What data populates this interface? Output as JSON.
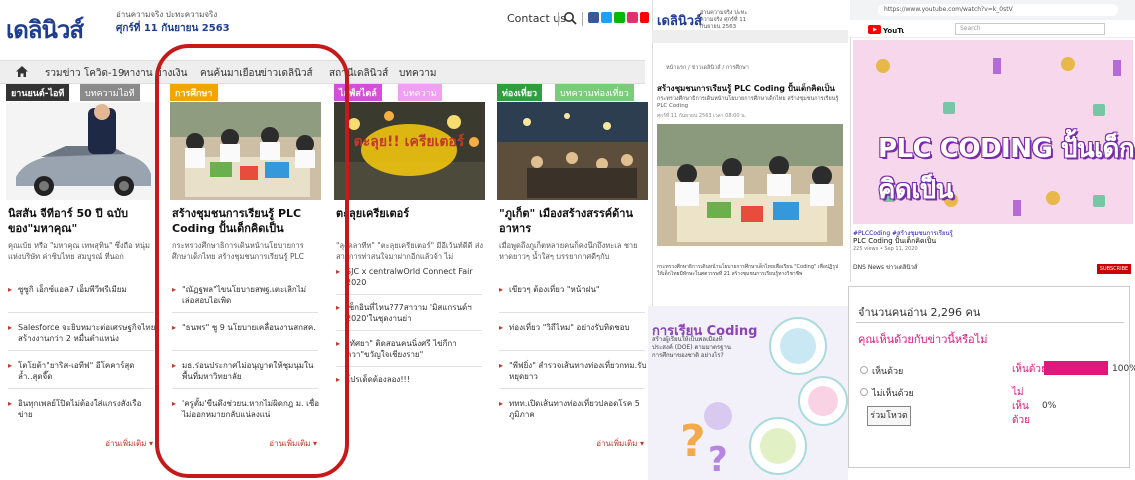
{
  "site": {
    "logo": "เดลินิวส์",
    "logo_tagline": "อ่านความจริง ปะทะความจริง",
    "date": "ศุกร์ที่ 11 กันยายน 2563",
    "contact": "Contact us",
    "nav": [
      "รวมข่าว โควิด-19",
      "หางาน",
      "ข้างเงิน",
      "คนค้นมาเยือน",
      "ข่าวเดลินิวส์",
      "สถานีเดลินิวส์",
      "บทความ"
    ],
    "columns": [
      {
        "tab": "ยานยนต์-ไอที",
        "tab2": "บทความไอที",
        "tab_color": "#333333",
        "tab2_color": "#8a8a8a",
        "title": "นิสสัน จีทีอาร์ 50 ปี ฉบับ ของ\"มหาคุณ\"",
        "excerpt": "คุณเบ้ย หรือ \"มหาคุณ เทพสุทิน\" ซึ่งถือ หนุ่มแห่งบริษัท ค่าซิบไทย สมบูรณ์ ที่นอก",
        "bullets": [
          "ซูซูกิ เอ็กซ์แอล7 เอ็มพีวีพรีเมียม",
          "Salesforce จะยิบหมาะต่อเศรษฐกิจไทย สร้างงานกว่า 2 หมื่นตำแหน่ง",
          "โตโยต้า\"ยาริส-เอทีฟ\" อีโคคาร์สุดล้ำ..สุดจี๊ด",
          "อินทุกเพลย์โปิดไม่ต้องใส่แกรงสังเรือข่าย"
        ],
        "more": "อ่านเพิ่มเติม ▾"
      },
      {
        "tab": "การศึกษา",
        "tab2": "",
        "tab_color": "#f0a500",
        "tab2_color": "",
        "title": "สร้างชุมชนการเรียนรู้ PLC Coding ปั้นเด็กคิดเป็น",
        "excerpt": "กระทรวงศึกษาธิการเดินหน้านโยบายการศึกษาเด็กไทย สร้างชุมชนการเรียนรู้ PLC",
        "bullets": [
          "\"ณัฏฐพล\"ไขนโยบายสพฐ.เตะเลิกไม่ เล่อสอบไอเพิด",
          "\"ธนพร\" ชู 9 นโยบายเคลื่อนงานสกสค.",
          "มธ.ร่อนประกาศไม่อนุญาตให้ชุมนุมใน พื้นที่มหาวิทยาลัย",
          "'ครูตั้ม'ขืนดึงช่วยน.หากไม่ผิดกฎ ม. เชื่อ ไม่ออกหมายกลับแน่ลงแน่"
        ],
        "more": "อ่านเพิ่มเติม ▾"
      },
      {
        "tab": "ไลฟ์สไตล์",
        "tab2": "บทความ",
        "tab_color": "#d24fd8",
        "tab2_color": "#f0a0f0",
        "title": "ตะลุยเครียเตอร์",
        "excerpt": "\"ลุงคลาทีท\" \"ตะลุยเครียเตอร์\" มีอีเว้นท์ดีดี ส่งสารการท่าสนใจมาฝากอีกแล้วจ้า ไม่",
        "bullets": [
          "SJC x centralwOrld Connect Fair 2020",
          "เช็กอินที่ไหน?77สาวาม 'มิสแกรนด์ฯ 2020'ในชุดงานย่า",
          "\"ทัศยา\" ติดสอนคนนิ่งศรี ไข่กีกา ควา\"ขวัญใจเชียงราย\"",
          "โปรเด็ดต้องลอง!!!"
        ],
        "more": ""
      },
      {
        "tab": "ท่องเที่ยว",
        "tab2": "บทความท่องเที่ยว",
        "tab_color": "#2e9e3e",
        "tab2_color": "#7acc7a",
        "title": "\"ภูเก็ต\" เมืองสร้างสรรค์ด้าน อาหาร",
        "excerpt": "เมื่อพูดถึงภูเก็ตหลายคนก็คงนึกถึงทะเล ชายหาดยาวๆ น้ำใสๆ บรรยากาศดีๆกับ",
        "bullets": [
          "เขียวๆ ต้องเที่ยว \"หน้าฝน\"",
          "ท่องเที่ยว \"วิถีไหม\" อย่างรับทิดชอบ",
          "\"พีฟยิ่ง\" สำรวจเส้นทางท่องเที่ยวกทม.รับหยุดยาว",
          "ททท.เปิดเส้นทางท่องเที่ยวปลอดโรค 5 ภูมิภาค"
        ],
        "more": "อ่านเพิ่มเติม ▾"
      }
    ],
    "thumb_captions": [
      "",
      "",
      "ตะลุย!! เครียเตอร์",
      ""
    ]
  },
  "article": {
    "logo": "เดลินิวส์",
    "logo_sub": "อ่านความจริง ปะทะความจริง ศุกร์ที่ 11 กันยายน 2563",
    "crumb": "หน้าแรก / ข่าวเดลินิวส์ / การศึกษา",
    "title": "สร้างชุมชนการเรียนรู้ PLC Coding ปั้นเด็กคิดเป็น",
    "lead": "กระทรวงศึกษาธิการเดินหน้านโยบายการศึกษาเด็กไทย สร้างชุมชนการเรียนรู้ PLC Coding",
    "date": "ศุกร์ที่ 11 กันยายน 2563 เวลา 08:00 น.",
    "body": "กระทรวงศึกษาธิการเดินหน้านโยบายการศึกษาเด็กไทยเพื่อเรียน \"Coding\" เพื่อปฏิรูปให้เด็กไทยมีทักษะในศตวรรษที่ 21 สร้างชุมชนการเรียนรู้ทางวิชาชีพ"
  },
  "youtube": {
    "url": "https://www.youtube.com/watch?v=k_0stV",
    "logo": "YouTube",
    "search": "Search",
    "video_title": "PLC CODING ปั้นเด็กคิดเป็น",
    "caption": "#PLCCoding #สร้างชุมชนการเรียนรู้",
    "title": "PLC Coding ปั้นเด็กคิดเป็น",
    "views": "225 views • Sep 11, 2020",
    "channel": "DNS News ข่าวเดลินิวส์",
    "subscribe": "SUBSCRIBE"
  },
  "coding": {
    "title": "การเรียน Coding",
    "desc": "สร้างผู้เรียนให้เป็นพลเมืองที่ประสงค์ (DOE) ตามมาตรฐานการศึกษาของชาติ อย่างไร?"
  },
  "poll": {
    "count": "จำนวนคนอ่าน 2,296 คน",
    "question": "คุณเห็นด้วยกับข่าวนี้หรือไม่",
    "options": [
      {
        "label": "เห็นด้วย",
        "result_label": "เห็นด้วย",
        "percent": 100,
        "percent_text": "100%"
      },
      {
        "label": "ไม่เห็นด้วย",
        "result_label": "ไม่เห็นด้วย",
        "percent": 0,
        "percent_text": "0%"
      }
    ],
    "vote": "ร่วมโหวต",
    "accent": "#e0187c"
  }
}
